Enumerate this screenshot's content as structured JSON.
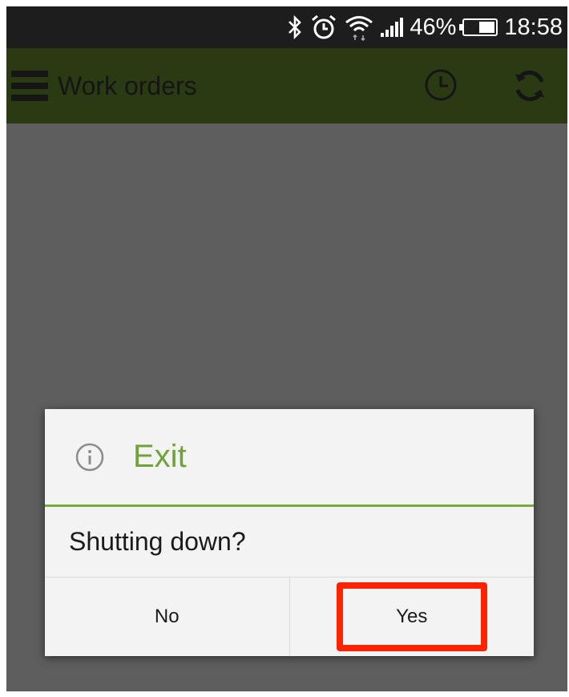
{
  "status_bar": {
    "battery": "46%",
    "time": "18:58",
    "icons": [
      "bluetooth-icon",
      "alarm-icon",
      "wifi-icon",
      "signal-icon",
      "battery-icon"
    ]
  },
  "app_bar": {
    "title": "Work orders",
    "color": "#2a3a12",
    "icons": [
      "menu-icon",
      "history-icon",
      "sync-icon"
    ]
  },
  "dialog": {
    "title": "Exit",
    "title_color": "#6fa238",
    "message": "Shutting down?",
    "no_label": "No",
    "yes_label": "Yes",
    "highlight_color": "#ff2200"
  }
}
